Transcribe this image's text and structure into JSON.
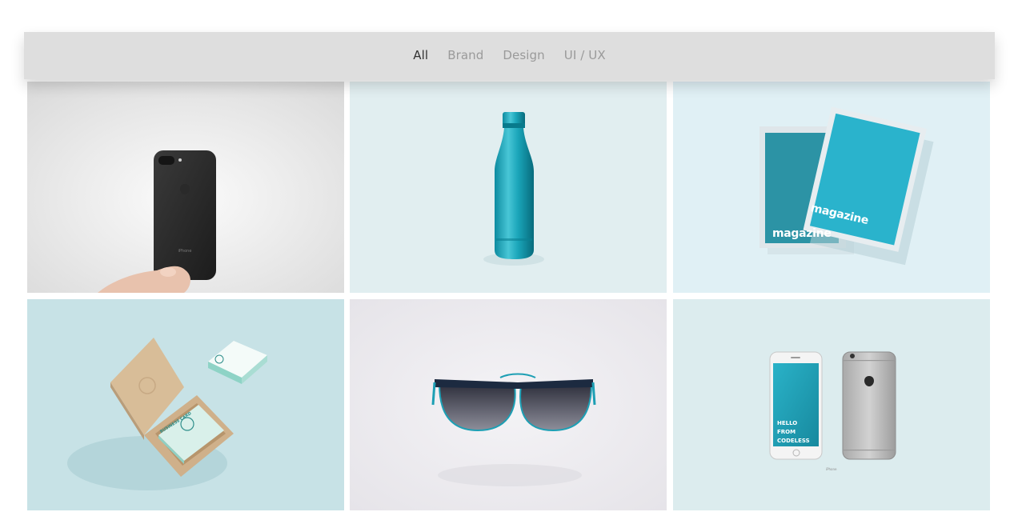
{
  "filters": [
    {
      "label": "All",
      "active": true
    },
    {
      "label": "Brand",
      "active": false
    },
    {
      "label": "Design",
      "active": false
    },
    {
      "label": "UI / UX",
      "active": false
    }
  ],
  "portfolio": [
    {
      "subject": "black-smartphone-in-hand",
      "phone_label": "iPhone",
      "bg": "#f1f1f1"
    },
    {
      "subject": "teal-water-bottle",
      "bg": "#e1eef0"
    },
    {
      "subject": "magazine-mockup",
      "back_title": "magazine",
      "front_title": "magazine",
      "bg": "#e0f0f5"
    },
    {
      "subject": "business-card-box",
      "card_text": "BUSINESS CARD",
      "bg": "#c7e2e6"
    },
    {
      "subject": "sunglasses",
      "bg": "#eceaee"
    },
    {
      "subject": "two-smartphones",
      "screen_text": "HELLO FROM CODELESS",
      "phone_label": "iPhone",
      "bg": "#dcecee"
    }
  ],
  "colors": {
    "accent": "#27a9c1",
    "filter_bar": "#dedede",
    "filter_active": "#333333",
    "filter_inactive": "#9a9a9a"
  }
}
